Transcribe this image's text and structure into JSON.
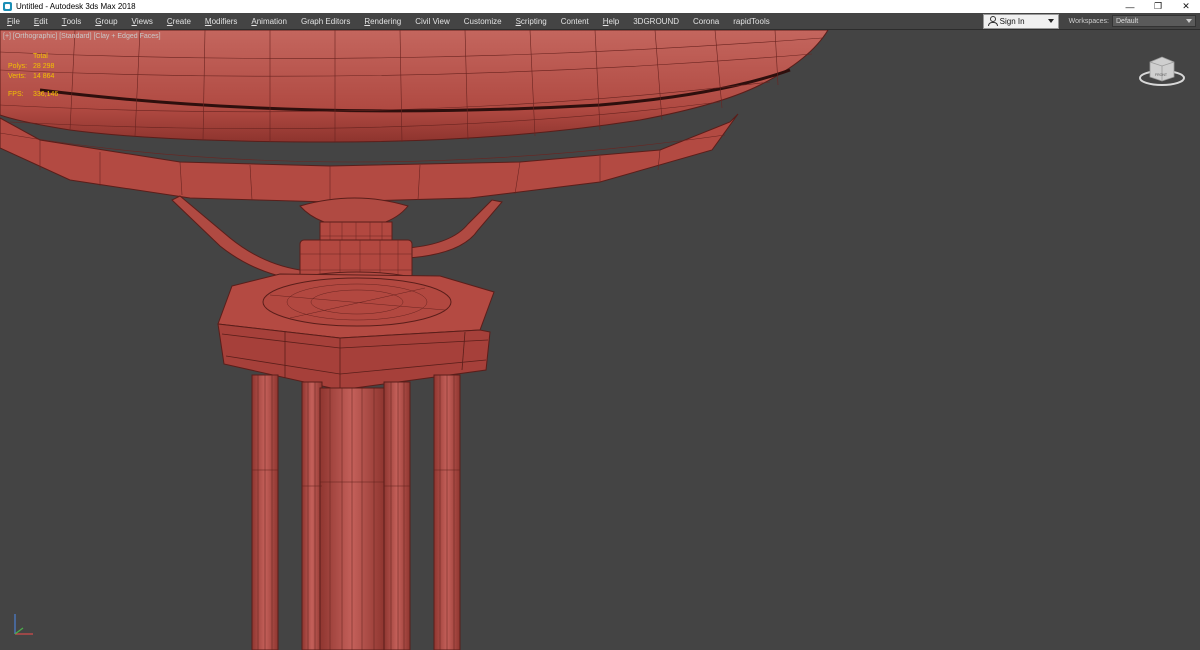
{
  "window": {
    "title": "Untitled - Autodesk 3ds Max 2018",
    "minimize_glyph": "—",
    "maximize_glyph": "❐",
    "close_glyph": "✕"
  },
  "menu": {
    "items": [
      {
        "label": "File",
        "ul": "F",
        "rest": "ile"
      },
      {
        "label": "Edit",
        "ul": "E",
        "rest": "dit"
      },
      {
        "label": "Tools",
        "ul": "T",
        "rest": "ools"
      },
      {
        "label": "Group",
        "ul": "G",
        "rest": "roup"
      },
      {
        "label": "Views",
        "ul": "V",
        "rest": "iews"
      },
      {
        "label": "Create",
        "ul": "C",
        "rest": "reate"
      },
      {
        "label": "Modifiers",
        "ul": "M",
        "rest": "odifiers"
      },
      {
        "label": "Animation",
        "ul": "A",
        "rest": "nimation"
      },
      {
        "label": "Graph Editors",
        "ul": "",
        "rest": "Graph Editors"
      },
      {
        "label": "Rendering",
        "ul": "R",
        "rest": "endering"
      },
      {
        "label": "Civil View",
        "ul": "",
        "rest": "Civil View"
      },
      {
        "label": "Customize",
        "ul": "",
        "rest": "Customize"
      },
      {
        "label": "Scripting",
        "ul": "S",
        "rest": "cripting"
      },
      {
        "label": "Content",
        "ul": "",
        "rest": "Content"
      },
      {
        "label": "Help",
        "ul": "H",
        "rest": "elp"
      },
      {
        "label": "3DGROUND",
        "ul": "",
        "rest": "3DGROUND"
      },
      {
        "label": "Corona",
        "ul": "",
        "rest": "Corona"
      },
      {
        "label": "rapidTools",
        "ul": "",
        "rest": "rapidTools"
      }
    ],
    "sign_in": "Sign In",
    "workspaces_label": "Workspaces:",
    "workspace_value": "Default"
  },
  "viewport": {
    "label": "[+] [Orthographic] [Standard] [Clay + Edged Faces]",
    "stats": {
      "header": "Total",
      "polys_label": "Polys:",
      "polys_value": "28 298",
      "verts_label": "Verts:",
      "verts_value": "14 864",
      "fps_label": "FPS:",
      "fps_value": "336,146"
    },
    "viewcube_face": "FRONT"
  },
  "colors": {
    "viewport_bg": "#444444",
    "model_fill": "#b24840",
    "model_wire": "#5a1e1a",
    "stats_text": "#f2c200"
  }
}
